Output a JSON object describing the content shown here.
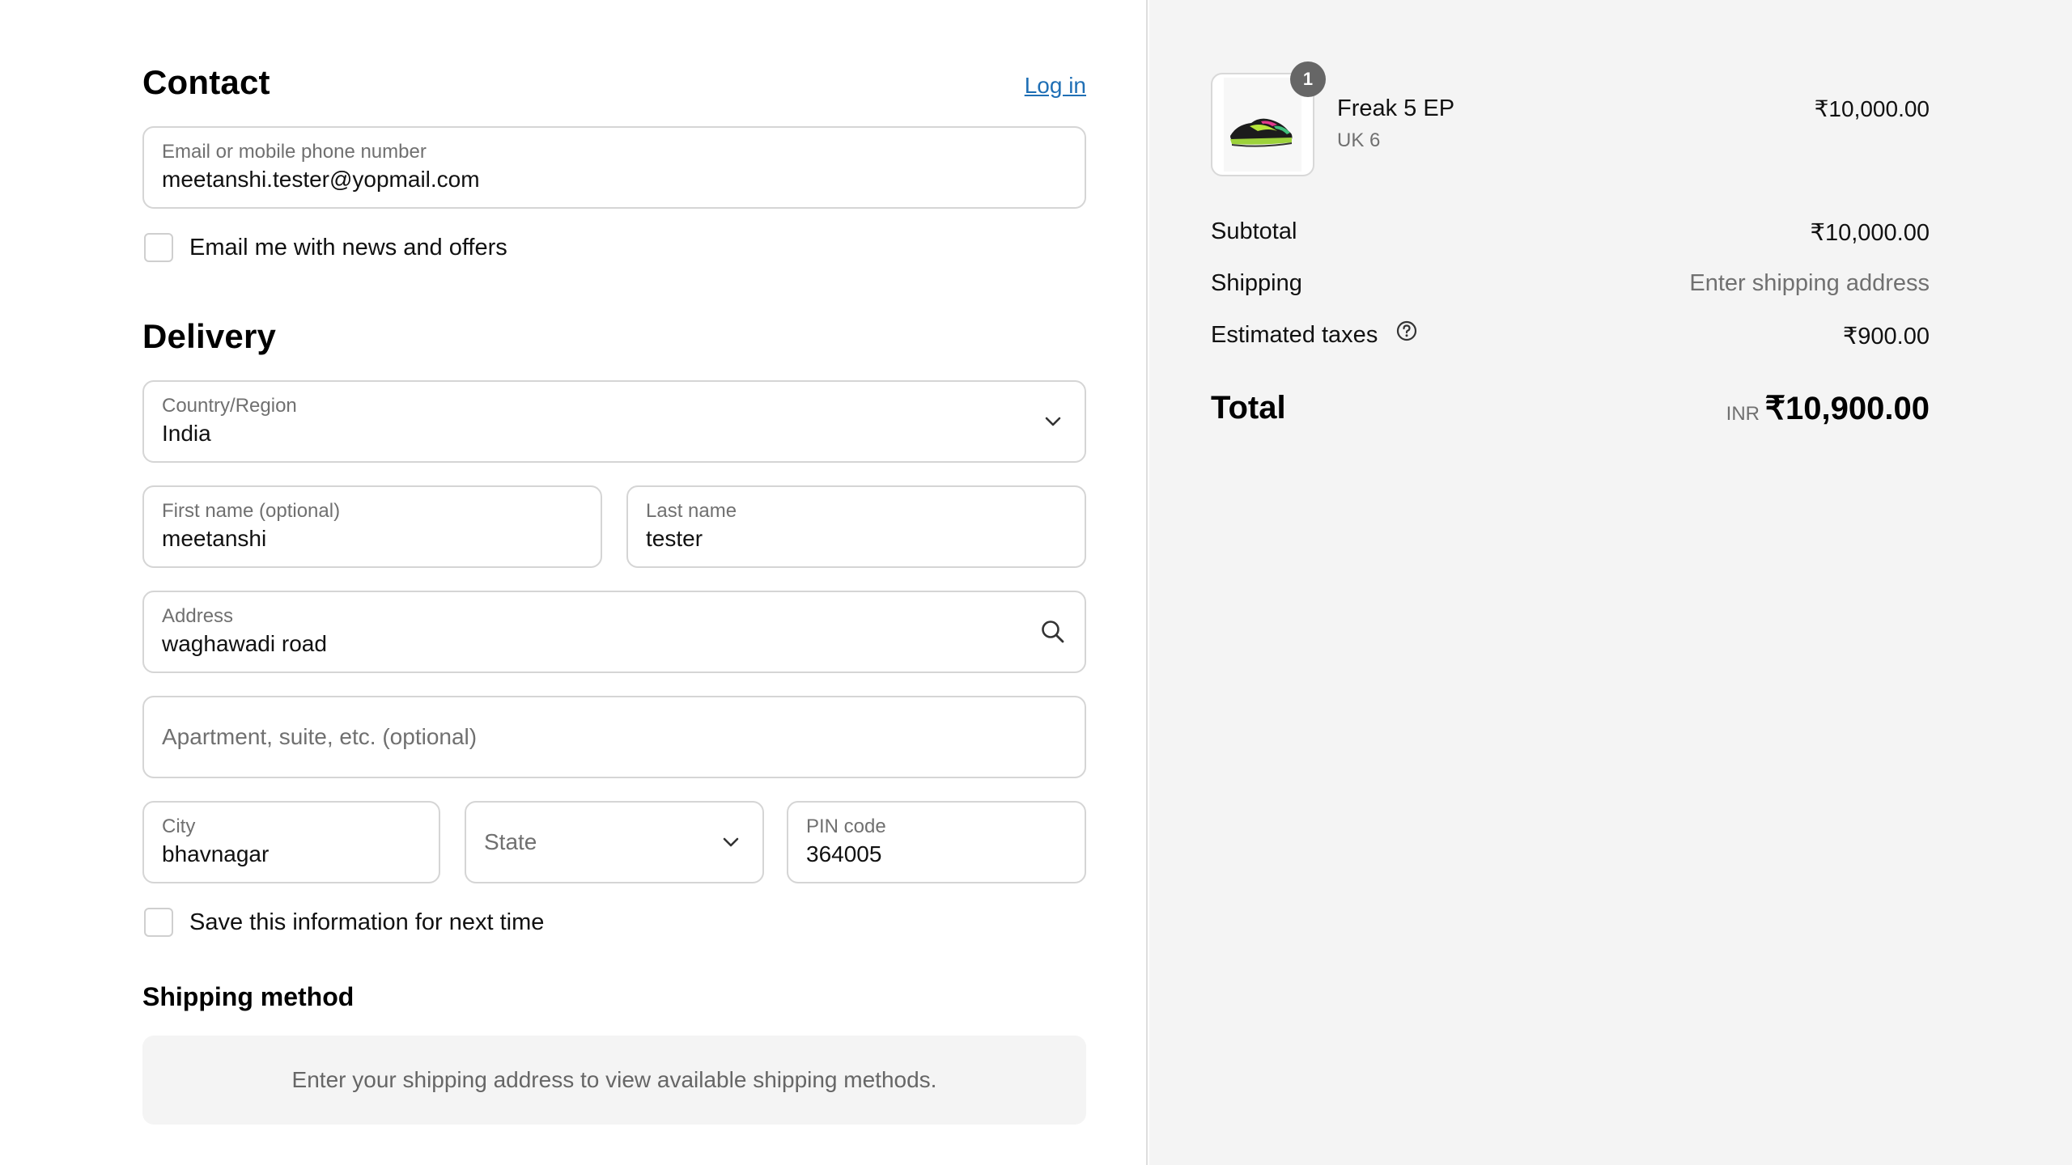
{
  "contact": {
    "heading": "Contact",
    "login_link": "Log in",
    "email_label": "Email or mobile phone number",
    "email_value": "meetanshi.tester@yopmail.com",
    "news_checkbox_label": "Email me with news and offers"
  },
  "delivery": {
    "heading": "Delivery",
    "country_label": "Country/Region",
    "country_value": "India",
    "first_name_label": "First name (optional)",
    "first_name_value": "meetanshi",
    "last_name_label": "Last name",
    "last_name_value": "tester",
    "address_label": "Address",
    "address_value": "waghawadi road",
    "apartment_placeholder": "Apartment, suite, etc. (optional)",
    "city_label": "City",
    "city_value": "bhavnagar",
    "state_placeholder": "State",
    "pin_label": "PIN code",
    "pin_value": "364005",
    "save_checkbox_label": "Save this information for next time"
  },
  "shipping_method": {
    "heading": "Shipping method",
    "message": "Enter your shipping address to view available shipping methods."
  },
  "summary": {
    "item": {
      "quantity_badge": "1",
      "name": "Freak 5 EP",
      "variant": "UK 6",
      "price": "₹10,000.00",
      "image_icon": "sneaker-image"
    },
    "subtotal_label": "Subtotal",
    "subtotal_value": "₹10,000.00",
    "shipping_label": "Shipping",
    "shipping_value": "Enter shipping address",
    "taxes_label": "Estimated taxes",
    "taxes_value": "₹900.00",
    "total_label": "Total",
    "total_currency": "INR",
    "total_value": "₹10,900.00"
  },
  "colors": {
    "link": "#1f6fb5",
    "summary_bg": "#f4f4f4",
    "border": "#d5d5d5"
  }
}
